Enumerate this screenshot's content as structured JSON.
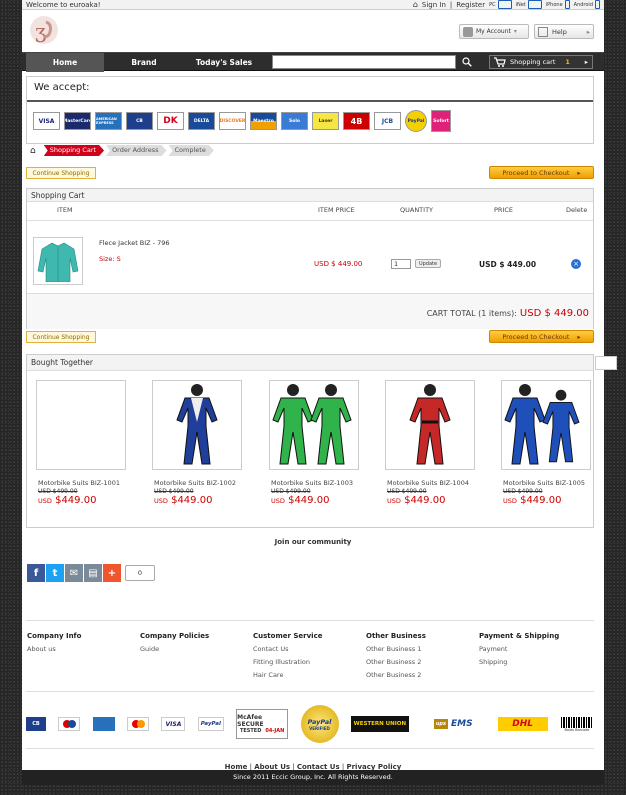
{
  "topbar": {
    "welcome": "Welcome to euroaka!",
    "sign_in": "Sign In",
    "sep": "|",
    "register": "Register",
    "devices": [
      "PC",
      "iNet",
      "iPhone",
      "Android"
    ]
  },
  "header": {
    "my_account": "My Account",
    "help": "Help"
  },
  "nav": {
    "items": [
      "Home",
      "Brand",
      "Today's Sales"
    ],
    "search_placeholder": "",
    "cart_label": "Shopping cart",
    "cart_count": "1"
  },
  "accept": {
    "title": "We accept:",
    "cards": [
      "VISA",
      "MasterCard",
      "AMERICAN EXPRESS",
      "CB",
      "DK",
      "DELTA",
      "DISCOVER",
      "Maestro",
      "Solo",
      "Laser",
      "4B",
      "JCB",
      "PayPal",
      "Sofort"
    ]
  },
  "steps": [
    "Shopping Cart",
    "Order Address",
    "Complete"
  ],
  "buttons": {
    "continue": "Continue Shopping",
    "checkout": "Proceed to Checkout"
  },
  "cart": {
    "title": "Shopping Cart",
    "columns": {
      "item": "ITEM",
      "item_price": "ITEM PRICE",
      "quantity": "QUANTITY",
      "price": "PRICE",
      "delete": "Delete"
    },
    "row": {
      "name": "Flece Jacket BIZ - 796",
      "size": "Size: S",
      "item_price": "USD $ 449.00",
      "qty": "1",
      "update": "Update",
      "price": "USD $ 449.00"
    },
    "total_label": "CART TOTAL (1 items):",
    "total_value": "USD $ 449.00"
  },
  "bought": {
    "title": "Bought Together",
    "products": [
      {
        "name": "Motorbike Suits BIZ-1001",
        "old": "USD $499.00",
        "cur": "USD",
        "price": "$449.00"
      },
      {
        "name": "Motorbike Suits BIZ-1002",
        "old": "USD $499.00",
        "cur": "USD",
        "price": "$449.00"
      },
      {
        "name": "Motorbike Suits BIZ-1003",
        "old": "USD $499.00",
        "cur": "USD",
        "price": "$449.00"
      },
      {
        "name": "Motorbike Suits BIZ-1004",
        "old": "USD $499.00",
        "cur": "USD",
        "price": "$449.00"
      },
      {
        "name": "Motorbike Suits BIZ-1005",
        "old": "USD $499.00",
        "cur": "USD",
        "price": "$449.00"
      }
    ]
  },
  "community": {
    "title": "Join our community",
    "share_count": "0"
  },
  "footer": {
    "columns": [
      {
        "title": "Company Info",
        "links": [
          "About us"
        ]
      },
      {
        "title": "Company Policies",
        "links": [
          "Guide"
        ]
      },
      {
        "title": "Customer Service",
        "links": [
          "Contact Us",
          "Fitting Illustration",
          "Hair Care"
        ]
      },
      {
        "title": "Other Business",
        "links": [
          "Other Business 1",
          "Other Business 2",
          "Other Business 2"
        ]
      },
      {
        "title": "Payment & Shipping",
        "links": [
          "Payment",
          "Shipping"
        ]
      }
    ],
    "logos": {
      "mcafee": "McAfee SECURE",
      "mcafee_sub": "TESTED",
      "mcafee_date": "04-JAN",
      "paypal": "PayPal",
      "paypal_sub": "VERIFIED",
      "western": "WESTERN UNION",
      "ems": "EMS",
      "dhl": "DHL",
      "barcode": "Bolds Barcode"
    },
    "links": [
      "Home",
      "About Us",
      "Contact Us",
      "Privacy Policy"
    ],
    "copyright": "Since 2011 Eccic Group, Inc. All Rights Reserved."
  },
  "colors": {
    "accent": "#d0021b",
    "price": "#cc0000",
    "checkout": "#f0a000",
    "nav": "#2d2d2d"
  }
}
